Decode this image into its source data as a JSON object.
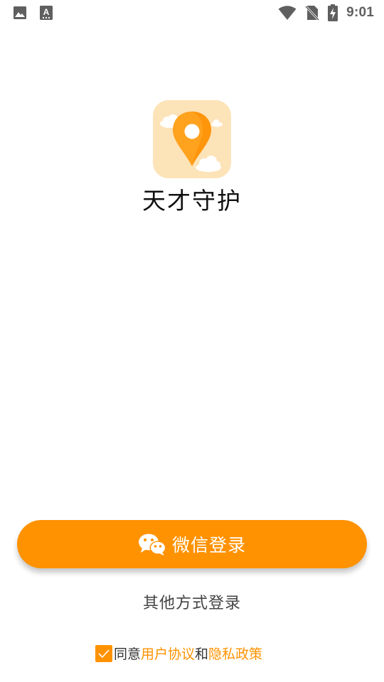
{
  "status_bar": {
    "time": "9:01",
    "left_icons": [
      "image-icon",
      "keyboard-a-icon"
    ],
    "right_icons": [
      "wifi-icon",
      "no-sim-icon",
      "battery-charging-icon"
    ]
  },
  "app": {
    "name": "天才守护",
    "icon": "location-pin-clouds-icon"
  },
  "login": {
    "wechat_label": "微信登录",
    "wechat_icon": "wechat-icon",
    "other_label": "其他方式登录"
  },
  "agreement": {
    "checked": true,
    "prefix": "同意",
    "user_agreement": "用户协议",
    "conjunction": "和",
    "privacy_policy": "隐私政策"
  },
  "colors": {
    "accent": "#ff9200",
    "icon_bg": "#fde3b8",
    "text": "#111111",
    "muted": "#444444"
  }
}
